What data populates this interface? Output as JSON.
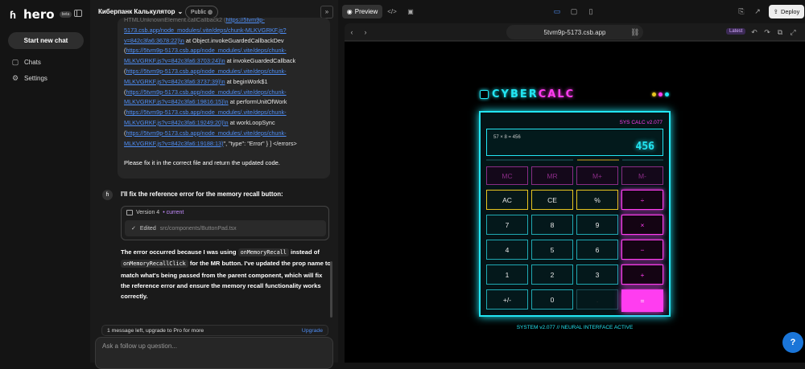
{
  "app": {
    "name": "hero",
    "badge": "beta"
  },
  "sidebar": {
    "new_chat": "Start new chat",
    "items": [
      {
        "label": "Chats",
        "icon": "chat-icon"
      },
      {
        "label": "Settings",
        "icon": "gear-icon"
      }
    ]
  },
  "chat": {
    "project_title": "Киберпанк Калькулятор",
    "visibility": "Public",
    "error_lines": [
      {
        "pre": "HTMLUnknownElement.callCallback2 (",
        "link": "https://5tvm9p-",
        "post": ""
      },
      {
        "pre": "",
        "link": "5173.csb.app/node_modules/.vite/deps/chunk-MLKVGRKF.js?",
        "post": ""
      },
      {
        "pre": "",
        "link": "v=842c3fa6:3678:22)\\n",
        "post": " at Object.invokeGuardedCallbackDev"
      },
      {
        "pre": "(",
        "link": "https://5tvm9p-5173.csb.app/node_modules/.vite/deps/chunk-",
        "post": ""
      },
      {
        "pre": "",
        "link": "MLKVGRKF.js?v=842c3fa6:3703:24)\\n",
        "post": " at invokeGuardedCallback"
      },
      {
        "pre": "(",
        "link": "https://5tvm9p-5173.csb.app/node_modules/.vite/deps/chunk-",
        "post": ""
      },
      {
        "pre": "",
        "link": "MLKVGRKF.js?v=842c3fa6:3737:39)\\n",
        "post": " at beginWork$1"
      },
      {
        "pre": "(",
        "link": "https://5tvm9p-5173.csb.app/node_modules/.vite/deps/chunk-",
        "post": ""
      },
      {
        "pre": "",
        "link": "MLKVGRKF.js?v=842c3fa6:19816:15)\\n",
        "post": " at performUnitOfWork"
      },
      {
        "pre": "(",
        "link": "https://5tvm9p-5173.csb.app/node_modules/.vite/deps/chunk-",
        "post": ""
      },
      {
        "pre": "",
        "link": "MLKVGRKF.js?v=842c3fa6:19249:20)\\n",
        "post": " at workLoopSync"
      },
      {
        "pre": "(",
        "link": "https://5tvm9p-5173.csb.app/node_modules/.vite/deps/chunk-",
        "post": ""
      },
      {
        "pre": "",
        "link": "MLKVGRKF.js?v=842c3fa6:19188:13)",
        "post": "\", \"type\": \"Error\" } ] </errors>"
      }
    ],
    "fix_request": "Please fix it in the correct file and return the updated code.",
    "ai_heading": "I'll fix the reference error for the memory recall button:",
    "version_label": "Version 4",
    "version_status": "• current",
    "edited_label": "Edited",
    "edited_path": "src/components/ButtonPad.tsx",
    "body_p1": "The error occurred because I was using",
    "code1": "onMemoryRecall",
    "body_p2": "instead of",
    "code2": "onMemoryRecallClick",
    "body_p3": "for the MR button. I've updated the prop name to match what's being passed from the parent component, which will fix the reference error and ensure the memory recall functionality works correctly.",
    "upgrade_text": "1 message left, upgrade to Pro for more",
    "upgrade_link": "Upgrade",
    "input_placeholder": "Ask a follow up question..."
  },
  "preview": {
    "tab_label": "Preview",
    "deploy_label": "Deploy",
    "url": "5tvm9p-5173.csb.app",
    "latest": "Latest"
  },
  "calculator": {
    "title_a": "CYBER",
    "title_b": "CALC",
    "sys_label": "SYS CALC v2.077",
    "expression": "57 × 8 = 456",
    "result": "456",
    "memory_buttons": [
      "MC",
      "MR",
      "M+",
      "M-"
    ],
    "rows": [
      [
        {
          "l": "AC",
          "t": "fn"
        },
        {
          "l": "CE",
          "t": "fn"
        },
        {
          "l": "%",
          "t": "fn"
        },
        {
          "l": "÷",
          "t": "op"
        }
      ],
      [
        {
          "l": "7",
          "t": "num"
        },
        {
          "l": "8",
          "t": "num"
        },
        {
          "l": "9",
          "t": "num"
        },
        {
          "l": "×",
          "t": "op"
        }
      ],
      [
        {
          "l": "4",
          "t": "num"
        },
        {
          "l": "5",
          "t": "num"
        },
        {
          "l": "6",
          "t": "num"
        },
        {
          "l": "−",
          "t": "op"
        }
      ],
      [
        {
          "l": "1",
          "t": "num"
        },
        {
          "l": "2",
          "t": "num"
        },
        {
          "l": "3",
          "t": "num"
        },
        {
          "l": "+",
          "t": "op"
        }
      ],
      [
        {
          "l": "+/-",
          "t": "num"
        },
        {
          "l": "0",
          "t": "num"
        },
        {
          "l": ".",
          "t": "dot"
        },
        {
          "l": "=",
          "t": "eq"
        }
      ]
    ],
    "footer": "SYSTEM v2.077 // NEURAL INTERFACE ACTIVE",
    "colors": {
      "cyan": "#22e6f3",
      "magenta": "#ff3df0",
      "yellow": "#e8c620"
    }
  }
}
